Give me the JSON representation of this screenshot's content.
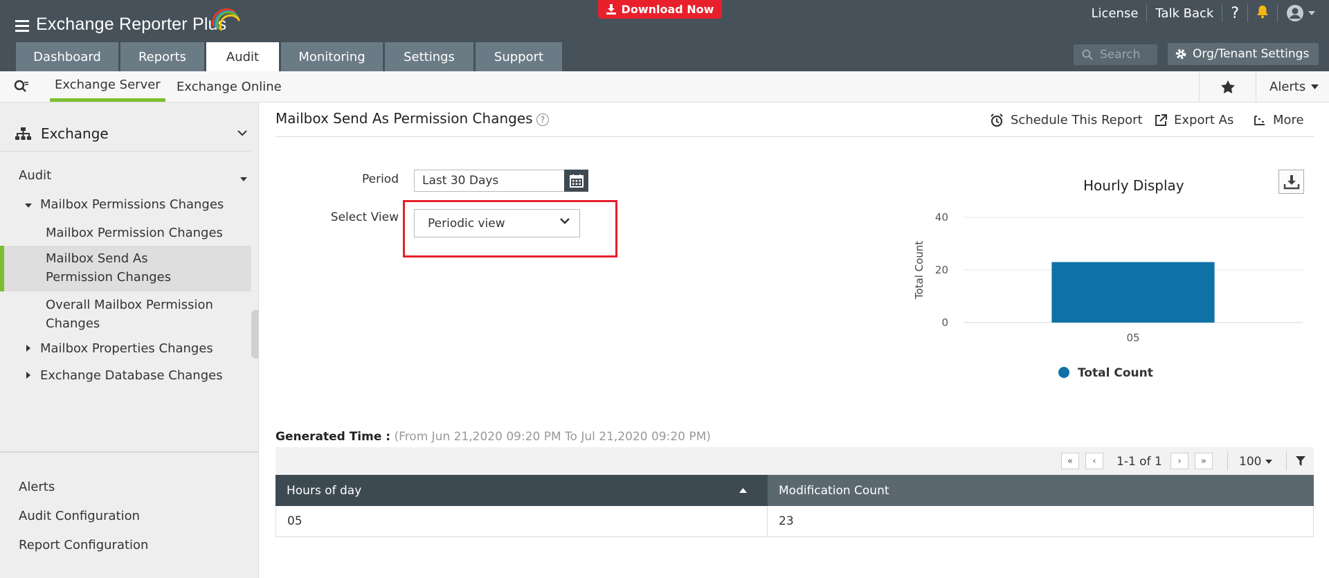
{
  "header": {
    "brand": "Exchange Reporter Plus",
    "download_label": "Download Now",
    "top_links": [
      "License",
      "Talk Back",
      "?"
    ],
    "nav_tabs": [
      "Dashboard",
      "Reports",
      "Audit",
      "Monitoring",
      "Settings",
      "Support"
    ],
    "active_tab": "Audit",
    "search_placeholder": "Search",
    "org_settings_label": "Org/Tenant Settings"
  },
  "subnav": {
    "tabs": [
      "Exchange Server",
      "Exchange Online"
    ],
    "active": "Exchange Server",
    "alerts_label": "Alerts"
  },
  "sidebar": {
    "section": "Exchange",
    "group": "Audit",
    "subgroup": "Mailbox Permissions Changes",
    "items": [
      "Mailbox Permission Changes",
      "Mailbox Send As Permission Changes",
      "Overall Mailbox Permission Changes"
    ],
    "collapsed_groups": [
      "Mailbox Properties Changes",
      "Exchange Database Changes"
    ],
    "bottom_links": [
      "Alerts",
      "Audit Configuration",
      "Report Configuration"
    ]
  },
  "report": {
    "title": "Mailbox Send As Permission Changes",
    "help": "?",
    "actions": [
      "Schedule This Report",
      "Export As",
      "More"
    ],
    "period_label": "Period",
    "period_value": "Last 30 Days",
    "view_label": "Select View",
    "view_value": "Periodic view"
  },
  "chart_data": {
    "type": "bar",
    "title": "Hourly Display",
    "categories": [
      "05"
    ],
    "series": [
      {
        "name": "Total Count",
        "values": [
          23
        ],
        "color": "#0f72a7"
      }
    ],
    "ylabel": "Total Count",
    "xlabel": "",
    "ylim": [
      0,
      40
    ],
    "yticks": [
      0,
      20,
      40
    ],
    "grid": true,
    "legend": "bottom"
  },
  "table": {
    "generated_label": "Generated Time :",
    "generated_range": "(From Jun 21,2020 09:20 PM To Jul 21,2020 09:20 PM)",
    "page_info": "1-1 of 1",
    "page_size": "100",
    "columns": [
      "Hours of day",
      "Modification Count"
    ],
    "rows": [
      [
        "05",
        "23"
      ]
    ]
  },
  "colors": {
    "header_bg": "#465159",
    "tab_bg": "#6b7b86",
    "accent_green": "#7cbe31",
    "download_red": "#e8202b",
    "bar_blue": "#0f72a7"
  }
}
